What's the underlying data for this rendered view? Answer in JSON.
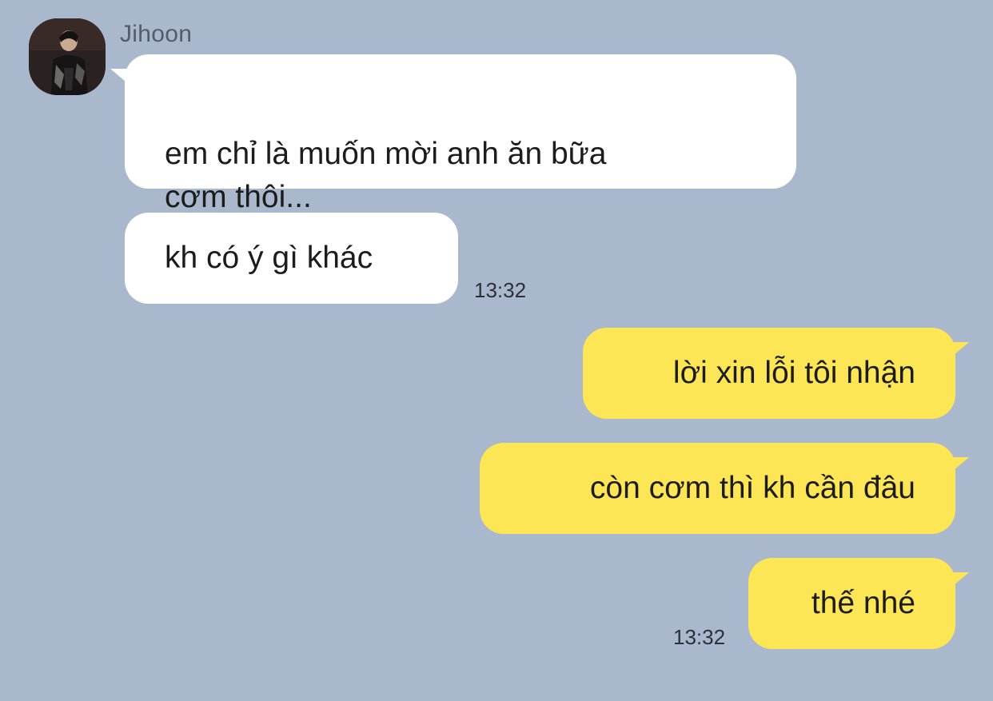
{
  "chat": {
    "sender": {
      "name": "Jihoon",
      "avatar_icon": "profile-photo"
    },
    "incoming": [
      {
        "text": "em chỉ là muốn mời anh ăn bữa\ncơm thôi..."
      },
      {
        "text": "kh có ý gì khác",
        "time": "13:32"
      }
    ],
    "outgoing": [
      {
        "text": "lời xin lỗi tôi nhận"
      },
      {
        "text": "còn cơm thì kh cần đâu"
      },
      {
        "text": "thế nhé",
        "time": "13:32"
      }
    ]
  },
  "colors": {
    "background": "#a9b8cd",
    "incoming_bubble": "#ffffff",
    "outgoing_bubble": "#fde655",
    "timestamp": "#2c3038",
    "sender_name": "#545c68"
  }
}
